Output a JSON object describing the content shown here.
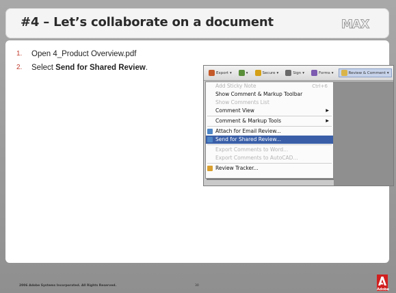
{
  "slide": {
    "title": "#4 – Let’s collaborate on a document",
    "logo_text": "MAX",
    "steps": [
      {
        "num": "1.",
        "text_before": "Open 4_Product Overview.pdf",
        "bold": "",
        "text_after": ""
      },
      {
        "num": "2.",
        "text_before": "Select ",
        "bold": "Send for Shared Review",
        "text_after": "."
      }
    ],
    "footer": {
      "copyright": "2006 Adobe Systems Incorporated.  All Rights Reserved.",
      "page": "30",
      "brand": "Adobe"
    }
  },
  "screenshot": {
    "toolbar": [
      {
        "label": "Export",
        "icon": "export-icon",
        "color": "#c45a2a"
      },
      {
        "label": "",
        "icon": "start-meeting-icon",
        "color": "#5a8f3a"
      },
      {
        "label": "Secure",
        "icon": "lock-icon",
        "color": "#d4a017"
      },
      {
        "label": "Sign",
        "icon": "pen-icon",
        "color": "#6a6a6a"
      },
      {
        "label": "Forms",
        "icon": "forms-icon",
        "color": "#7c5bb0"
      },
      {
        "label": "Review & Comment",
        "icon": "comment-icon",
        "color": "#d9b44a"
      }
    ],
    "menu": [
      {
        "label": "Add Sticky Note",
        "shortcut": "Ctrl+6",
        "disabled": true
      },
      {
        "label": "Show Comment & Markup Toolbar",
        "disabled": false
      },
      {
        "label": "Show Comments List",
        "disabled": true
      },
      {
        "label": "Comment View",
        "submenu": true,
        "disabled": false
      },
      {
        "sep": true
      },
      {
        "label": "Comment & Markup Tools",
        "submenu": true,
        "disabled": false
      },
      {
        "sep": true
      },
      {
        "label": "Attach for Email Review...",
        "icon": "email-review-icon",
        "disabled": false
      },
      {
        "label": "Send for Shared Review...",
        "icon": "shared-review-icon",
        "selected": true,
        "disabled": false
      },
      {
        "sep": true
      },
      {
        "label": "Export Comments to Word...",
        "disabled": true
      },
      {
        "label": "Export Comments to AutoCAD...",
        "disabled": true
      },
      {
        "sep": true
      },
      {
        "label": "Review Tracker...",
        "icon": "review-tracker-icon",
        "disabled": false
      }
    ]
  },
  "colors": {
    "accent_red": "#c0392b",
    "menu_selection": "#3a5fa8"
  }
}
